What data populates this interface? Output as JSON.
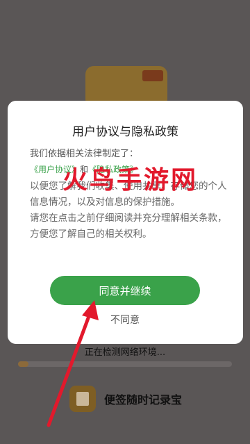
{
  "background": {
    "status_text": "正在检测网络环境...",
    "progress_fraction": 0.05,
    "bottom_app_name": "便签随时记录宝"
  },
  "dialog": {
    "title": "用户协议与隐私政策",
    "intro": "我们依据相关法律制定了：",
    "link_user_agreement": "《用户协议》",
    "link_and": "和",
    "link_privacy_policy": "《隐私政策》",
    "body_line1": "以便您了解我们收集、使用共享、存储您的个人信息情况，以及对信息的保护措施。",
    "body_line2": "请您在点击之前仔细阅读并充分理解相关条款，方便您了解自己的相关权利。",
    "agree_button": "同意并继续",
    "disagree_button": "不同意"
  },
  "watermark": "火鸟手游网",
  "colors": {
    "accent_green": "#3aa24a",
    "watermark_red": "#e2192c",
    "overlay": "#5a5656"
  }
}
